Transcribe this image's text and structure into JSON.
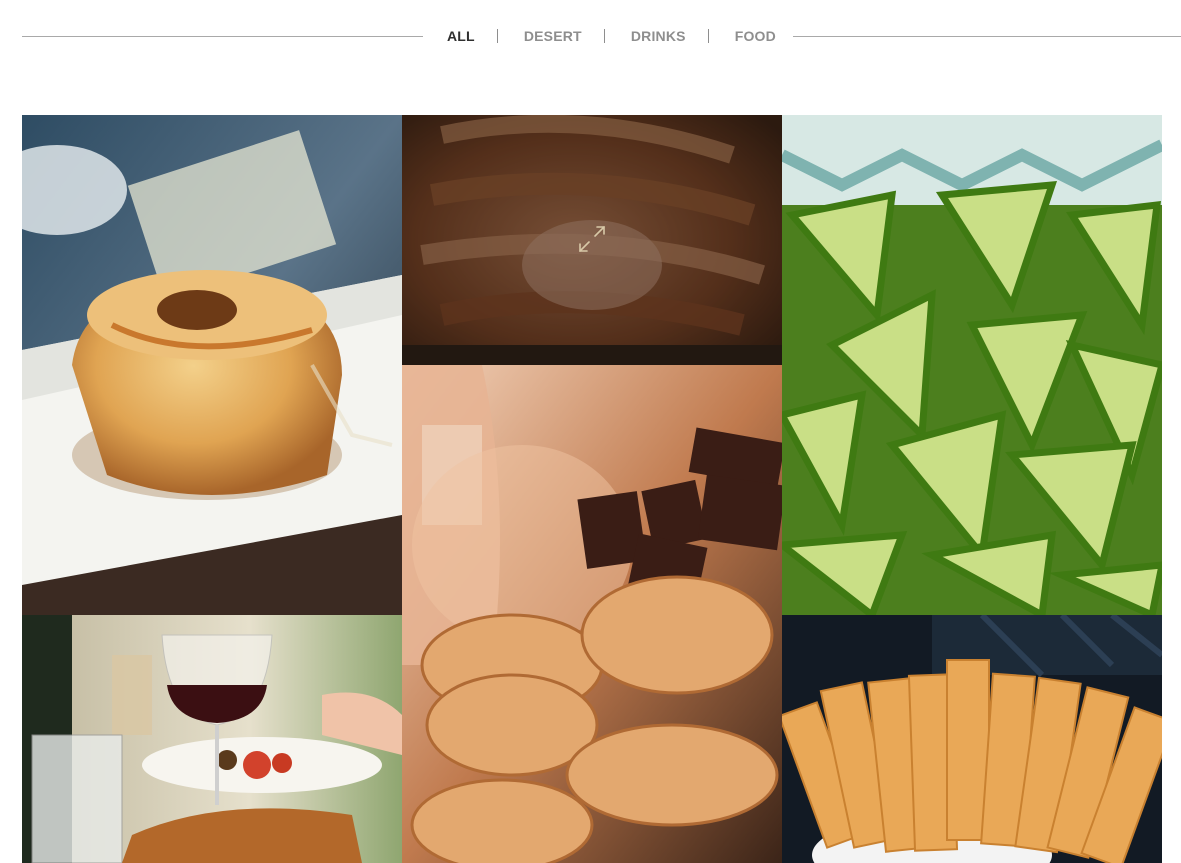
{
  "filters": [
    {
      "label": "ALL",
      "active": true
    },
    {
      "label": "DESERT",
      "active": false
    },
    {
      "label": "DRINKS",
      "active": false
    },
    {
      "label": "FOOD",
      "active": false
    }
  ],
  "gallery": {
    "items": [
      {
        "name": "doughnut-cake-photo"
      },
      {
        "name": "glazed-pork-photo",
        "hovered": true,
        "hover_icon": "expand-icon"
      },
      {
        "name": "lime-wedges-photo"
      },
      {
        "name": "chocolate-cookies-photo"
      },
      {
        "name": "red-wine-dinner-photo"
      },
      {
        "name": "cheese-slices-photo"
      }
    ]
  },
  "colors": {
    "active_filter": "#2f2f2f",
    "inactive_filter": "#8e8e8e",
    "rule": "#a9a9a9"
  }
}
